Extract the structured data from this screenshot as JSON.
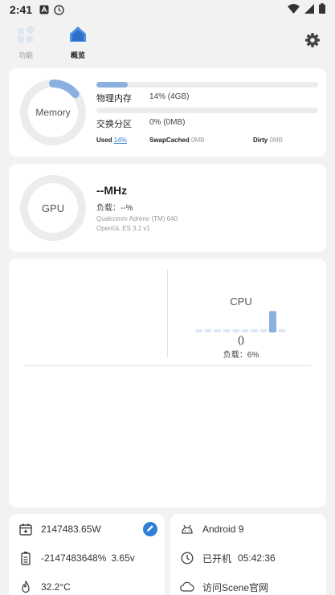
{
  "status_bar": {
    "time": "2:41"
  },
  "nav": {
    "tabs": [
      {
        "label": "功能"
      },
      {
        "label": "概览"
      }
    ]
  },
  "memory": {
    "ring_label": "Memory",
    "ring_percent": 14,
    "physical": {
      "label": "物理内存",
      "value": "14% (4GB)",
      "percent": 14
    },
    "swap": {
      "label": "交换分区",
      "value": "0% (0MB)",
      "percent": 0
    },
    "used_label": "Used",
    "used_value": "14%",
    "swapcached_label": "SwapCached",
    "swapcached_value": "0MB",
    "dirty_label": "Dirty",
    "dirty_value": "0MB"
  },
  "gpu": {
    "ring_label": "GPU",
    "freq": "--MHz",
    "load_label": "负载：",
    "load_value": "--%",
    "renderer": "Qualcomm Adreno (TM) 640",
    "gl_version": "OpenGL ES 3.1 v1"
  },
  "cpu": {
    "label": "CPU",
    "freq": "()",
    "load_label": "负载：",
    "load_value": "6%",
    "core_loads": [
      0,
      0,
      0,
      0,
      0,
      0,
      0,
      0,
      95,
      0
    ]
  },
  "footer_left": {
    "power": "2147483.65W",
    "battery_percent": "-2147483648%",
    "battery_voltage": "3.65v",
    "temperature": "32.2°C"
  },
  "footer_right": {
    "android": "Android 9",
    "uptime_label": "已开机",
    "uptime_value": "05:42:36",
    "visit": "访问Scene官网"
  },
  "colors": {
    "accent": "#2f7fd8",
    "ring": "#8ab0df",
    "ring_track": "#ececec",
    "bar_light": "#dce8f7"
  }
}
